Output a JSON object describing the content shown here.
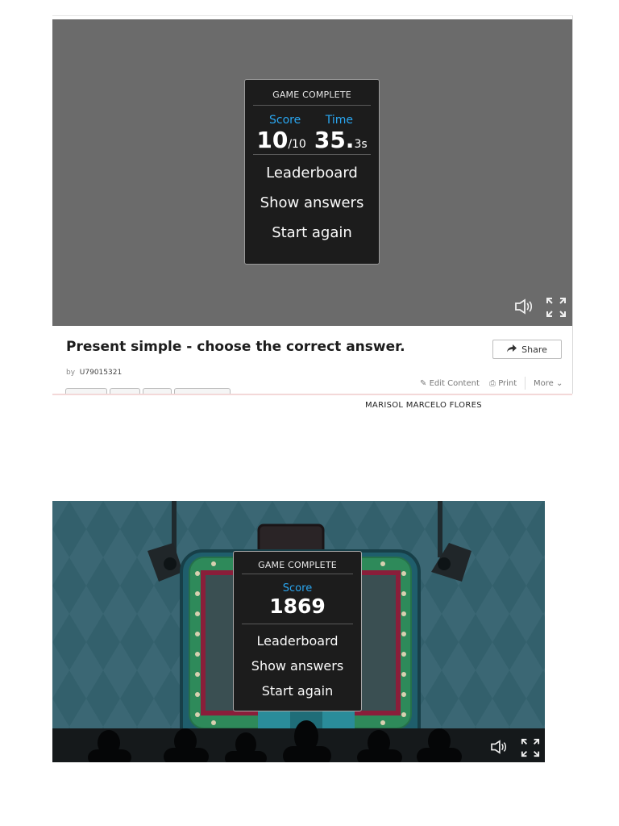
{
  "game1": {
    "panel_title": "GAME COMPLETE",
    "score_label": "Score",
    "time_label": "Time",
    "score_value": "10",
    "score_total": "/10",
    "time_main": "35.",
    "time_fraction": "3s",
    "menu": [
      "Leaderboard",
      "Show answers",
      "Start again"
    ]
  },
  "activity": {
    "title": "Present simple - choose the correct answer.",
    "by_label": "by",
    "author_id": "U79015321",
    "share_label": "Share",
    "edit_label": "Edit Content",
    "print_label": "Print",
    "more_label": "More"
  },
  "student_name": "MARISOL MARCELO FLORES",
  "game2": {
    "panel_title": "GAME COMPLETE",
    "score_label": "Score",
    "score_value": "1869",
    "menu": [
      "Leaderboard",
      "Show answers",
      "Start again"
    ]
  },
  "icons": {
    "sound": "speaker-icon",
    "fullscreen": "fullscreen-icon",
    "share": "share-arrow-icon",
    "edit": "pencil-icon",
    "print": "printer-icon",
    "more": "chevron-down-icon"
  },
  "colors": {
    "stage1_bg": "#6b6b6b",
    "panel_bg": "#1c1c1c",
    "accent_blue": "#2aa6f0",
    "stage2_bg": "#3a6673"
  }
}
